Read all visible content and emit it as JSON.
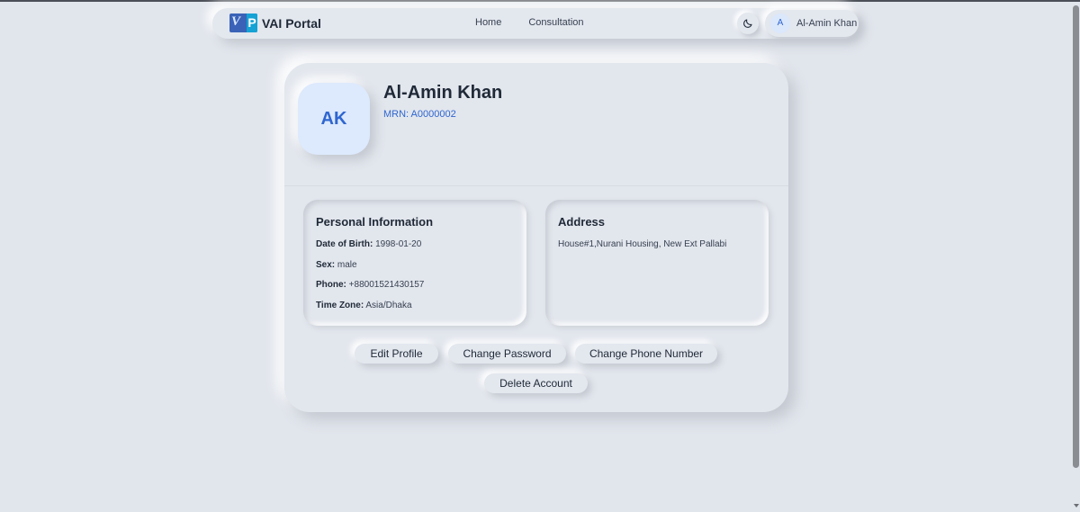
{
  "brand": {
    "name": "VAI Portal",
    "logo_letters": [
      "V",
      "P"
    ]
  },
  "nav": {
    "links": [
      "Home",
      "Consultation"
    ]
  },
  "theme_toggle": {
    "icon": "moon-icon"
  },
  "user": {
    "initial": "A",
    "name": "Al-Amin Khan"
  },
  "profile": {
    "initials": "AK",
    "name": "Al-Amin Khan",
    "mrn": "MRN: A0000002"
  },
  "personal_info": {
    "title": "Personal Information",
    "rows": [
      {
        "label": "Date of Birth:",
        "value": "1998-01-20"
      },
      {
        "label": "Sex:",
        "value": "male"
      },
      {
        "label": "Phone:",
        "value": "+88001521430157"
      },
      {
        "label": "Time Zone:",
        "value": "Asia/Dhaka"
      }
    ]
  },
  "address": {
    "title": "Address",
    "text": "House#1,Nurani Housing, New Ext Pallabi"
  },
  "actions": {
    "edit_profile": "Edit Profile",
    "change_password": "Change Password",
    "change_phone": "Change Phone Number",
    "delete_account": "Delete Account"
  },
  "colors": {
    "background": "#e1e5ec",
    "accent": "#2f66d0",
    "text": "#1f2937"
  }
}
